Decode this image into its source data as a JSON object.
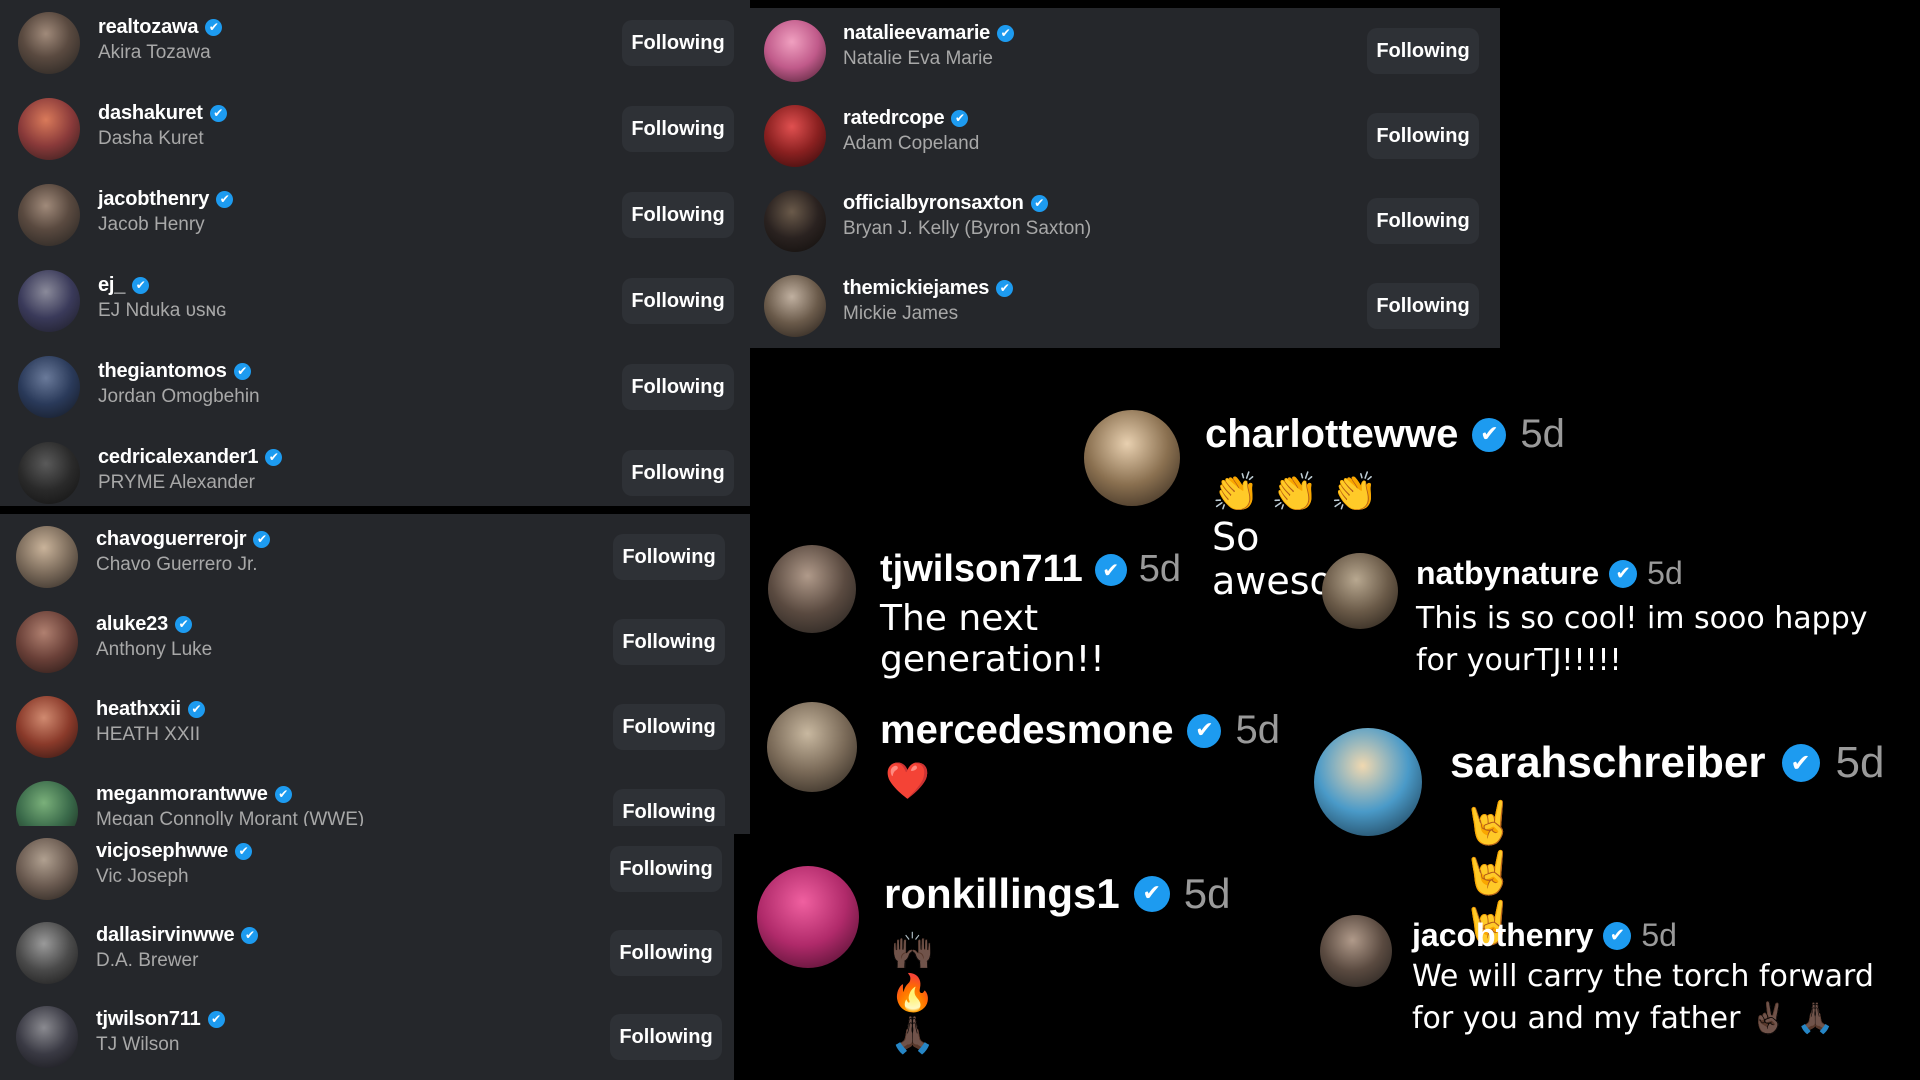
{
  "follow_button_label": "Following",
  "verified_glyph": "✔",
  "panel_a": [
    {
      "username": "realtozawa",
      "full_name": "Akira Tozawa"
    },
    {
      "username": "dashakuret",
      "full_name": "Dasha Kuret"
    },
    {
      "username": "jacobthenry",
      "full_name": "Jacob Henry"
    },
    {
      "username": "ej_",
      "full_name": "EJ Nduka ᴜsɴɢ"
    },
    {
      "username": "thegiantomos",
      "full_name": "Jordan Omogbehin"
    },
    {
      "username": "cedricalexander1",
      "full_name": "PRYME Alexander"
    }
  ],
  "panel_b": [
    {
      "username": "chavoguerrerojr",
      "full_name": "Chavo Guerrero Jr."
    },
    {
      "username": "aluke23",
      "full_name": "Anthony Luke"
    },
    {
      "username": "heathxxii",
      "full_name": "HEATH XXII"
    },
    {
      "username": "meganmorantwwe",
      "full_name": "Megan Connolly Morant (WWE)"
    }
  ],
  "panel_c": [
    {
      "username": "vicjosephwwe",
      "full_name": "Vic Joseph"
    },
    {
      "username": "dallasirvinwwe",
      "full_name": "D.A. Brewer"
    },
    {
      "username": "tjwilson711",
      "full_name": "TJ Wilson"
    }
  ],
  "panel_d": [
    {
      "username": "natalieevamarie",
      "full_name": "Natalie Eva Marie"
    },
    {
      "username": "ratedrcope",
      "full_name": "Adam Copeland"
    },
    {
      "username": "officialbyronsaxton",
      "full_name": "Bryan J. Kelly (Byron Saxton)"
    },
    {
      "username": "themickiejames",
      "full_name": "Mickie James"
    }
  ],
  "comments": {
    "charlotte": {
      "username": "charlottewwe",
      "time": "5d",
      "text": "👏 👏 👏 So awesome"
    },
    "tjwilson": {
      "username": "tjwilson711",
      "time": "5d",
      "text": "The next generation!!"
    },
    "natbynature": {
      "username": "natbynature",
      "time": "5d",
      "text": "This is so cool! im sooo happy for yourTJ!!!!!"
    },
    "mercedes": {
      "username": "mercedesmone",
      "time": "5d",
      "text": "❤️"
    },
    "sarah": {
      "username": "sarahschreiber",
      "time": "5d",
      "text": "🤘 🤘 🤘"
    },
    "ronkillings": {
      "username": "ronkillings1",
      "time": "5d",
      "text": "🙌🏿 🔥 🙏🏿"
    },
    "jacobthenry": {
      "username": "jacobthenry",
      "time": "5d",
      "text": "We will carry the torch forward for you and my father ✌🏿 🙏🏿"
    }
  }
}
